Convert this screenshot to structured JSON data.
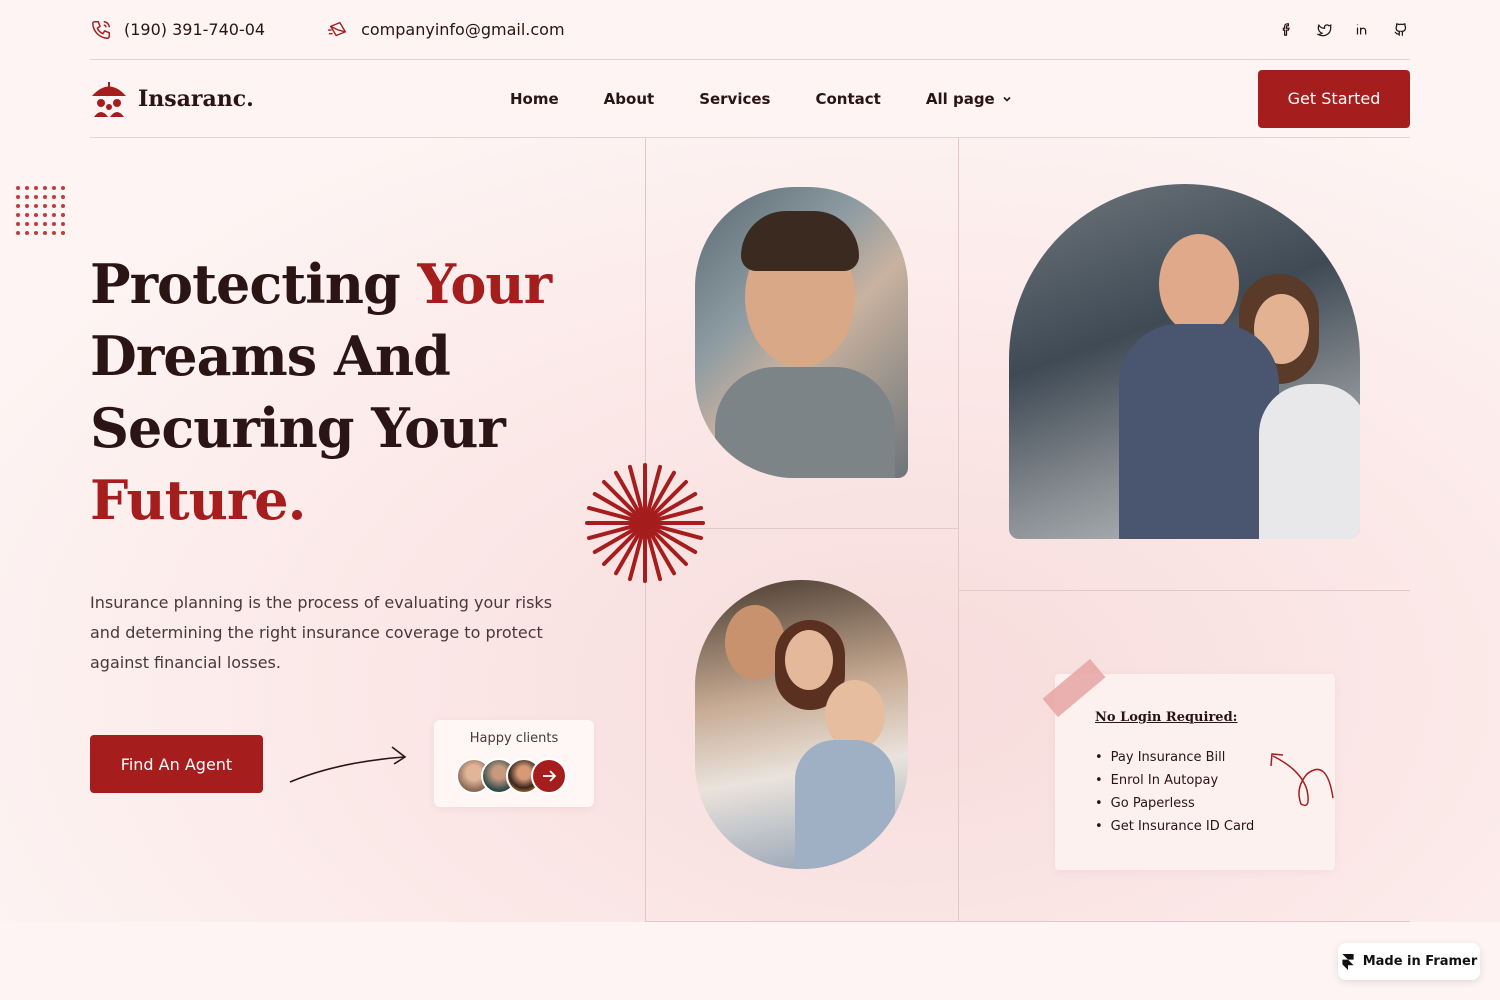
{
  "topbar": {
    "phone": "(190) 391-740-04",
    "email": "companyinfo@gmail.com",
    "socials": [
      "facebook-icon",
      "twitter-icon",
      "linkedin-icon",
      "github-icon"
    ]
  },
  "navbar": {
    "logo_text": "Insaranc.",
    "items": [
      {
        "label": "Home"
      },
      {
        "label": "About"
      },
      {
        "label": "Services"
      },
      {
        "label": "Contact"
      },
      {
        "label": "All page"
      }
    ],
    "cta_label": "Get Started"
  },
  "hero": {
    "headline": {
      "part1": "Protecting ",
      "accent1": "Your",
      "part2": "Dreams And",
      "part3": "Securing Your",
      "accent2": "Future."
    },
    "description": "Insurance planning is the process of evaluating your risks and determining the right insurance coverage to protect against financial losses.",
    "cta_label": "Find An Agent",
    "happy_clients_label": "Happy clients"
  },
  "note_card": {
    "title": "No Login Required:",
    "items": [
      "Pay Insurance Bill",
      "Enrol In Autopay",
      "Go Paperless",
      "Get Insurance ID Card"
    ]
  },
  "badge": {
    "label": "Made in Framer"
  },
  "colors": {
    "accent": "#a61d1d",
    "background": "#fdf4f3",
    "text": "#2a1414"
  }
}
